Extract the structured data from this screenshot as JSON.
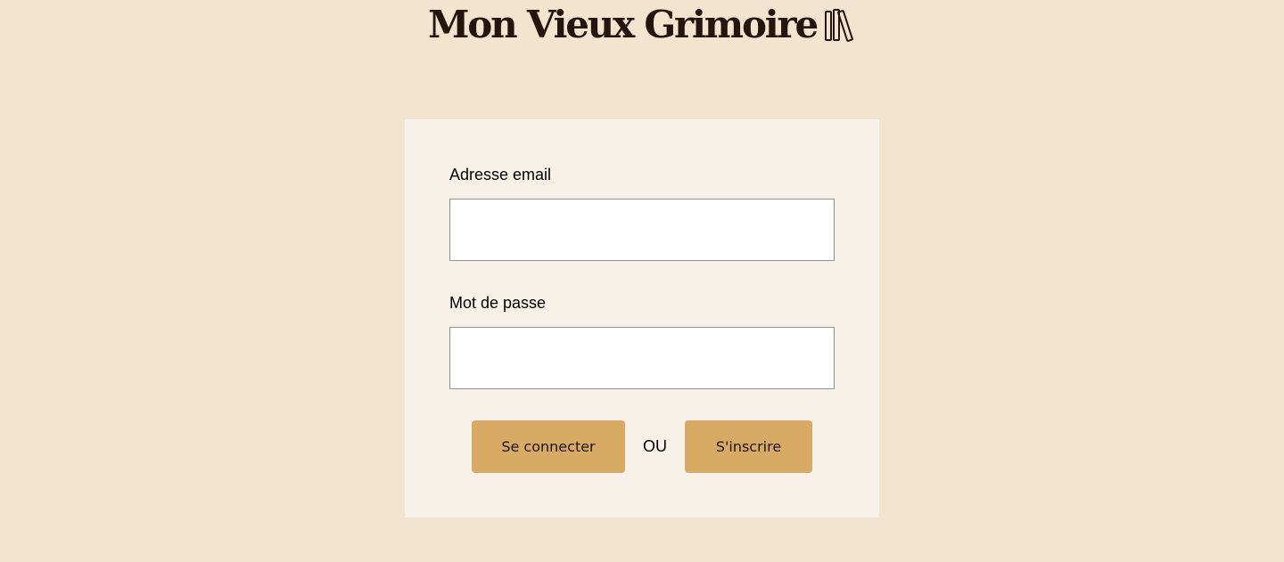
{
  "header": {
    "app_title": "Mon Vieux Grimoire",
    "logo_icon": "books-icon"
  },
  "login_form": {
    "email": {
      "label": "Adresse email",
      "value": "",
      "placeholder": ""
    },
    "password": {
      "label": "Mot de passe",
      "value": "",
      "placeholder": ""
    },
    "login_button_label": "Se connecter",
    "separator_text": "OU",
    "signup_button_label": "S'inscrire"
  },
  "colors": {
    "page_background": "#F2E4CE",
    "card_background": "#F7F1EA",
    "button_background": "#D8AA63",
    "title_color": "#24160F"
  }
}
